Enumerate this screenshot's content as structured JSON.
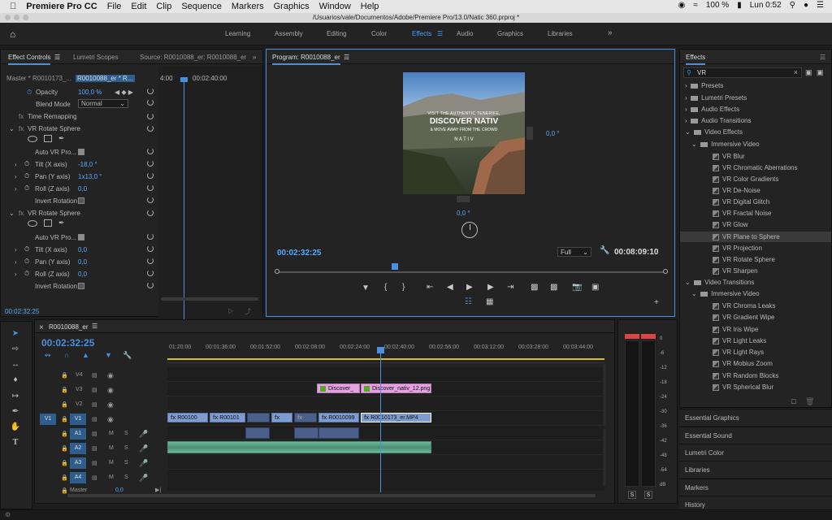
{
  "macbar": {
    "app": "Premiere Pro CC",
    "menus": [
      "File",
      "Edit",
      "Clip",
      "Sequence",
      "Markers",
      "Graphics",
      "Window",
      "Help"
    ],
    "battery": "100 %",
    "time": "Lun 0:52"
  },
  "titlebar": {
    "path": "/Usuarios/vale/Documentos/Adobe/Premiere Pro/13.0/Natic 360.prproj *"
  },
  "workspaces": [
    "Learning",
    "Assembly",
    "Editing",
    "Color",
    "Effects",
    "Audio",
    "Graphics",
    "Libraries"
  ],
  "effect_controls": {
    "tabs": [
      "Effect Controls",
      "Lumetri Scopes",
      "Source: R0010088_er: R0010088_er"
    ],
    "master": "Master * R0010173_...",
    "clip": "R0010088_er * R...",
    "tc_start": "4:00",
    "tc_mid": "00:02:40:00",
    "opacity_label": "Opacity",
    "opacity_value": "100,0 %",
    "blend_label": "Blend Mode",
    "blend_value": "Normal",
    "time_remap": "Time Remapping",
    "fx1": "VR Rotate Sphere",
    "fx2": "VR Rotate Sphere",
    "auto_vr": "Auto VR Pro...",
    "tilt_label": "Tilt (X axis)",
    "tilt_value": "-18,0 °",
    "pan_label": "Pan (Y axis)",
    "pan_value": "1x13,0 °",
    "roll_label": "Roll (Z axis)",
    "roll_value": "0,0",
    "invert": "Invert Rotation",
    "tilt2_value": "0,0",
    "pan2_value": "0,0",
    "roll2_value": "0,0",
    "timecode": "00:02:32:25"
  },
  "program": {
    "title": "Program: R0010088_er",
    "overlay_line1": "VISIT THE AUTHENTIC TENERIFE,",
    "overlay_line2": "DISCOVER NATIV",
    "overlay_line3": "& MOVE AWAY FROM THE CROWD",
    "overlay_brand": "N A T I V",
    "angle_right": "0,0 °",
    "angle_bottom": "0,0 °",
    "timecode": "00:02:32:25",
    "quality": "Full",
    "duration": "00:08:09:10"
  },
  "effects": {
    "title": "Effects",
    "search": "VR",
    "folders": [
      "Presets",
      "Lumetri Presets",
      "Audio Effects",
      "Audio Transitions",
      "Video Effects",
      "Immersive Video"
    ],
    "video_effects": [
      "VR Blur",
      "VR Chromatic Aberrations",
      "VR Color Gradients",
      "VR De-Noise",
      "VR Digital Glitch",
      "VR Fractal Noise",
      "VR Glow",
      "VR Plane to Sphere",
      "VR Projection",
      "VR Rotate Sphere",
      "VR Sharpen"
    ],
    "vt_folder": "Video Transitions",
    "vt_sub": "Immersive Video",
    "video_transitions": [
      "VR Chroma Leaks",
      "VR Gradient Wipe",
      "VR Iris Wipe",
      "VR Light Leaks",
      "VR Light Rays",
      "VR Mobius Zoom",
      "VR Random Blocks",
      "VR Spherical Blur"
    ],
    "selected": "VR Plane to Sphere"
  },
  "right_panels": [
    "Essential Graphics",
    "Essential Sound",
    "Lumetri Color",
    "Libraries",
    "Markers",
    "History"
  ],
  "timeline": {
    "tab": "R0010088_er",
    "timecode": "00:02:32:25",
    "ruler": [
      "01:20:00",
      "00:01:36:00",
      "00:01:52:00",
      "00:02:08:00",
      "00:02:24:00",
      "00:02:40:00",
      "00:02:56:00",
      "00:03:12:00",
      "00:03:28:00",
      "00:03:44:00"
    ],
    "tracks_v": [
      "V4",
      "V3",
      "V2",
      "V1"
    ],
    "tracks_a": [
      "A1",
      "A2",
      "A3",
      "A4"
    ],
    "master": "Master",
    "master_val": "0,0",
    "source_v": "V1",
    "clips_v3": [
      "Discover_",
      "Discover_nativ_12.png"
    ],
    "clips_v1": [
      "R00100",
      "R00101",
      "R0010099",
      "R0010173_er.MP4"
    ]
  },
  "meter": {
    "ticks": [
      "0",
      "-6",
      "-12",
      "-18",
      "-24",
      "-30",
      "-36",
      "-42",
      "-48",
      "-54",
      "dB"
    ],
    "solo": [
      "S",
      "S"
    ]
  }
}
